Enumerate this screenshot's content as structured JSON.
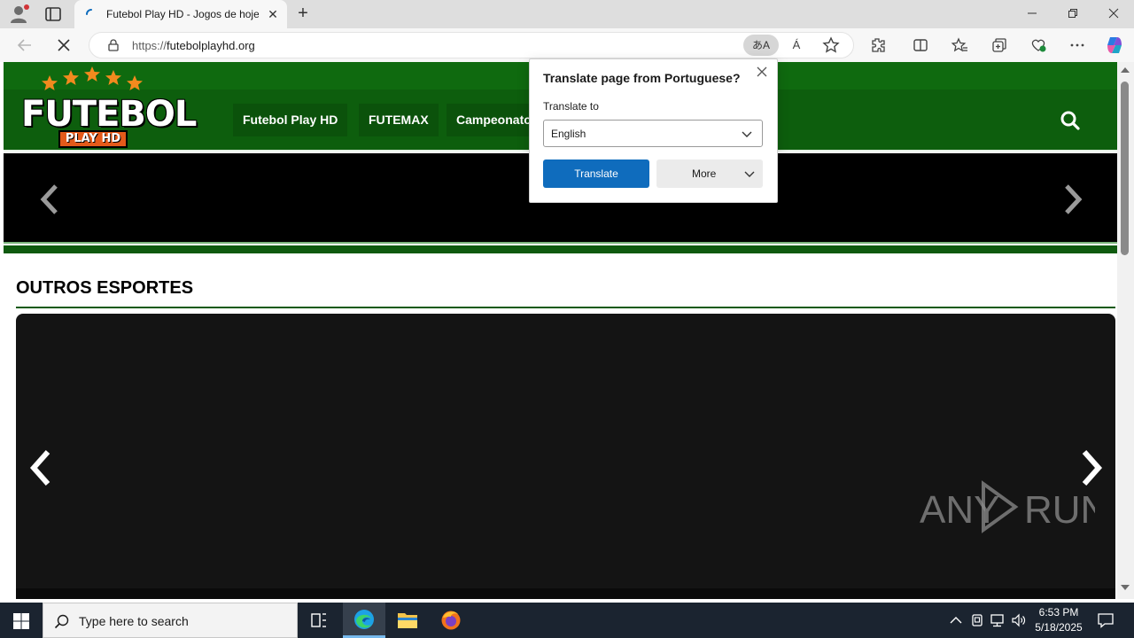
{
  "browser": {
    "tab_title": "Futebol Play HD - Jogos de hoje",
    "url_scheme": "https://",
    "url_host": "futebolplayhd.org",
    "new_tab_label": "+",
    "translate_icon_glyph": "あA",
    "read_aloud_glyph": "Á",
    "minimize_glyph": "—",
    "maximize_glyph": "❐",
    "close_glyph": "✕"
  },
  "site": {
    "logo_text": "FUTEBOL",
    "logo_sub": "PLAY HD",
    "nav": [
      "Futebol Play HD",
      "FUTEMAX",
      "Campeonato"
    ],
    "section_title": "OUTROS ESPORTES",
    "colors": {
      "header_green": "#0d5e0d",
      "accent_orange": "#f28a1e"
    }
  },
  "translate_popup": {
    "title": "Translate page from Portuguese?",
    "target_label": "Translate to",
    "target_value": "English",
    "translate_button": "Translate",
    "more_button": "More"
  },
  "watermark": "ANY RUN",
  "taskbar": {
    "search_placeholder": "Type here to search",
    "time": "6:53 PM",
    "date": "5/18/2025"
  }
}
